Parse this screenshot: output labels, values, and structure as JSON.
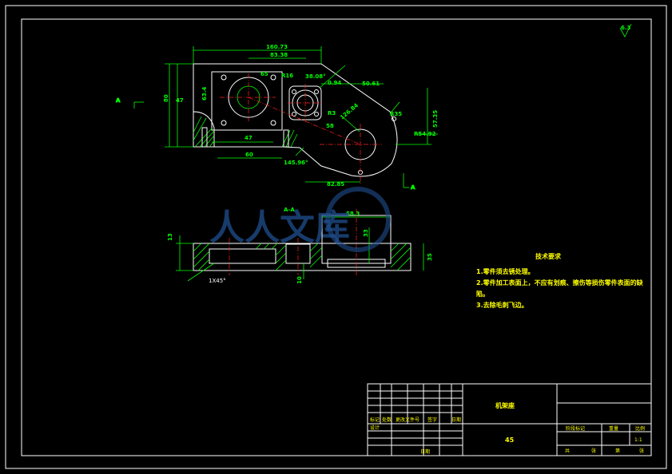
{
  "roughness": "6.3",
  "plan_view": {
    "dims": [
      "160.73",
      "83.38",
      "65",
      "47",
      "60",
      "63.4",
      "80",
      "38.08°",
      "R16",
      "0.94",
      "50.61",
      "R54.92",
      "R35",
      "57.35",
      "126.84",
      "58",
      "47",
      "145.96°",
      "82.85",
      "R3"
    ],
    "section_marker": "A"
  },
  "section_view": {
    "title": "A-A",
    "dims": [
      "58.3",
      "13",
      "33",
      "10",
      "35",
      "1X45°"
    ]
  },
  "technical_requirements": {
    "title": "技术要求",
    "items": [
      "1.零件须去锈处理。",
      "2.零件加工表面上，不应有划痕、擦伤等损伤零件表面的缺",
      "陷。",
      "3.去除毛刺飞边。"
    ]
  },
  "title_block": {
    "part_name": "机架座",
    "material": "45",
    "scale": "1:1",
    "labels": {
      "mark": "标记",
      "count": "处数",
      "zone": "更改文件号",
      "sign": "签字",
      "date": "日期",
      "designer": "设计",
      "stage_mark": "阶段标记",
      "weight": "重量",
      "ratio": "比例",
      "sheet": "共",
      "sheet_of": "张",
      "page": "第",
      "approve": "日期"
    }
  },
  "watermark": {
    "text": "人人文库"
  }
}
